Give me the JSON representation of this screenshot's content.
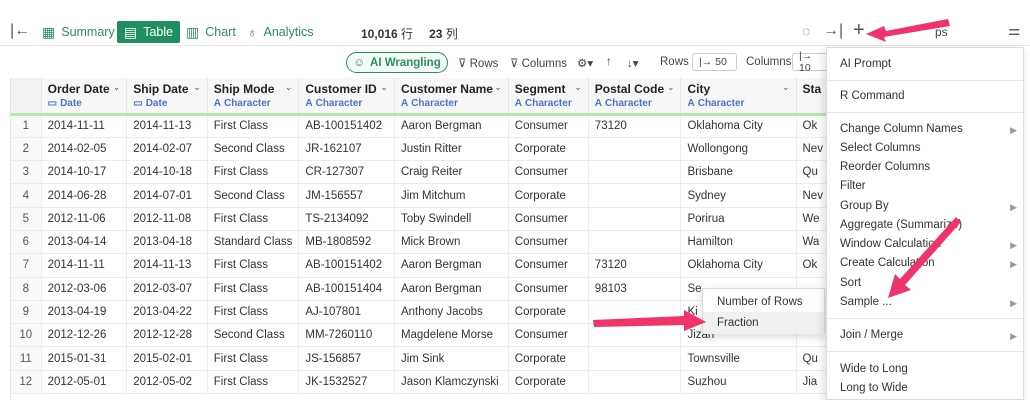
{
  "toolbar": {
    "tabs": [
      {
        "label": "Summary",
        "icon": "summary-icon"
      },
      {
        "label": "Table",
        "icon": "table-icon"
      },
      {
        "label": "Chart",
        "icon": "chart-icon"
      },
      {
        "label": "Analytics",
        "icon": "analytics-icon"
      }
    ],
    "rows_count": "10,016",
    "rows_unit": "行",
    "cols_count": "23",
    "cols_unit": "列",
    "add_step_label": "+",
    "hidden_text": "ps"
  },
  "subbar": {
    "ai_wrangling": "AI Wrangling",
    "rows": "Rows",
    "columns": "Columns",
    "rows_label": "Rows",
    "rows_value": "|→ 50",
    "columns_label": "Columns",
    "columns_value": "|→ 10"
  },
  "table": {
    "columns": [
      {
        "name": "Order Date",
        "type": "Date",
        "tag": "▭"
      },
      {
        "name": "Ship Date",
        "type": "Date",
        "tag": "▭"
      },
      {
        "name": "Ship Mode",
        "type": "Character",
        "tag": "A"
      },
      {
        "name": "Customer ID",
        "type": "Character",
        "tag": "A"
      },
      {
        "name": "Customer Name",
        "type": "Character",
        "tag": "A"
      },
      {
        "name": "Segment",
        "type": "Character",
        "tag": "A"
      },
      {
        "name": "Postal Code",
        "type": "Character",
        "tag": "A"
      },
      {
        "name": "City",
        "type": "Character",
        "tag": "A"
      },
      {
        "name": "Sta",
        "type": "",
        "tag": ""
      }
    ],
    "rows": [
      [
        "1",
        "2014-11-11",
        "2014-11-13",
        "First Class",
        "AB-100151402",
        "Aaron Bergman",
        "Consumer",
        "73120",
        "Oklahoma City",
        "Ok"
      ],
      [
        "2",
        "2014-02-05",
        "2014-02-07",
        "Second Class",
        "JR-162107",
        "Justin Ritter",
        "Corporate",
        "",
        "Wollongong",
        "Nev"
      ],
      [
        "3",
        "2014-10-17",
        "2014-10-18",
        "First Class",
        "CR-127307",
        "Craig Reiter",
        "Consumer",
        "",
        "Brisbane",
        "Qu"
      ],
      [
        "4",
        "2014-06-28",
        "2014-07-01",
        "Second Class",
        "JM-156557",
        "Jim Mitchum",
        "Corporate",
        "",
        "Sydney",
        "Nev"
      ],
      [
        "5",
        "2012-11-06",
        "2012-11-08",
        "First Class",
        "TS-2134092",
        "Toby Swindell",
        "Consumer",
        "",
        "Porirua",
        "We"
      ],
      [
        "6",
        "2013-04-14",
        "2013-04-18",
        "Standard Class",
        "MB-1808592",
        "Mick Brown",
        "Consumer",
        "",
        "Hamilton",
        "Wa"
      ],
      [
        "7",
        "2014-11-11",
        "2014-11-13",
        "First Class",
        "AB-100151402",
        "Aaron Bergman",
        "Consumer",
        "73120",
        "Oklahoma City",
        "Ok"
      ],
      [
        "8",
        "2012-03-06",
        "2012-03-07",
        "First Class",
        "AB-100151404",
        "Aaron Bergman",
        "Consumer",
        "98103",
        "Se",
        ""
      ],
      [
        "9",
        "2013-04-19",
        "2013-04-22",
        "First Class",
        "AJ-107801",
        "Anthony Jacobs",
        "Corporate",
        "",
        "Ki",
        ""
      ],
      [
        "10",
        "2012-12-26",
        "2012-12-28",
        "Second Class",
        "MM-7260110",
        "Magdelene Morse",
        "Consumer",
        "",
        "Jizan",
        ""
      ],
      [
        "11",
        "2015-01-31",
        "2015-02-01",
        "First Class",
        "JS-156857",
        "Jim Sink",
        "Corporate",
        "",
        "Townsville",
        "Qu"
      ],
      [
        "12",
        "2012-05-01",
        "2012-05-02",
        "First Class",
        "JK-1532527",
        "Jason Klamczynski",
        "Corporate",
        "",
        "Suzhou",
        "Jia"
      ]
    ]
  },
  "menu": {
    "items": [
      {
        "label": "AI Prompt",
        "submenu": false
      },
      {
        "label": "R Command",
        "submenu": false
      },
      {
        "label": "Change Column Names",
        "submenu": true
      },
      {
        "label": "Select Columns",
        "submenu": false
      },
      {
        "label": "Reorder Columns",
        "submenu": false
      },
      {
        "label": "Filter",
        "submenu": false
      },
      {
        "label": "Group By",
        "submenu": true
      },
      {
        "label": "Aggregate (Summarize)",
        "submenu": false
      },
      {
        "label": "Window Calculation",
        "submenu": true
      },
      {
        "label": "Create Calculation",
        "submenu": true
      },
      {
        "label": "Sort",
        "submenu": false
      },
      {
        "label": "Sample ...",
        "submenu": true
      },
      {
        "label": "Join / Merge",
        "submenu": true
      },
      {
        "label": "Wide to Long",
        "submenu": false
      },
      {
        "label": "Long to Wide",
        "submenu": false
      }
    ]
  },
  "submenu": {
    "items": [
      {
        "label": "Number of Rows"
      },
      {
        "label": "Fraction"
      }
    ]
  },
  "colors": {
    "accent_green": "#1f8f5f",
    "type_blue": "#4a74c9",
    "arrow_pink": "#f0336b"
  }
}
